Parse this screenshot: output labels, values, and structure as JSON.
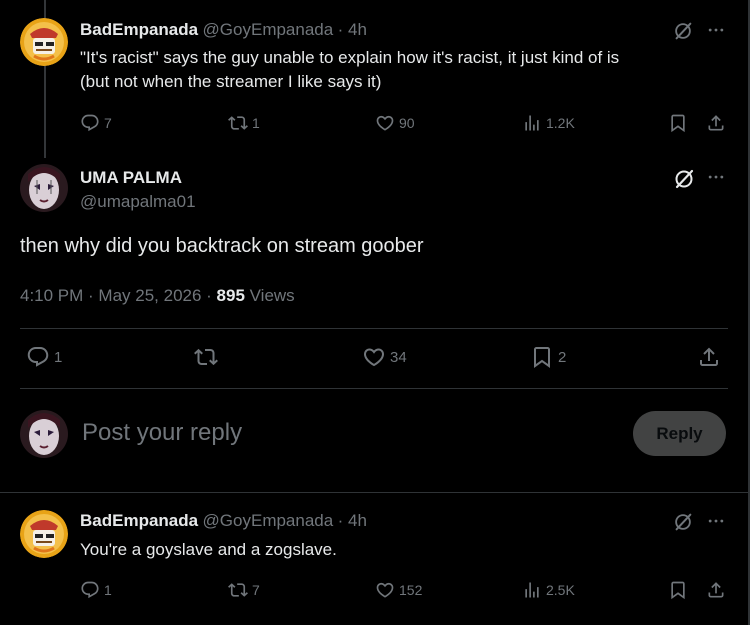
{
  "tweet1": {
    "name": "BadEmpanada",
    "handle": "@GoyEmpanada",
    "time": "· 4h",
    "text_line1": "\"It's racist\" says the guy unable to explain how it's racist, it just kind of is",
    "text_line2": "(but not when the streamer I like says it)",
    "replies": "7",
    "reposts": "1",
    "likes": "90",
    "views": "1.2K"
  },
  "main_tweet": {
    "name": "UMA PALMA",
    "handle": "@umapalma01",
    "text": "then why did you backtrack on stream goober",
    "timestamp": "4:10 PM · May 25, 2026 · ",
    "view_count": "895",
    "views_label": " Views",
    "replies": "1",
    "reposts": "",
    "likes": "34",
    "bookmarks": "2"
  },
  "composer": {
    "placeholder": "Post your reply",
    "reply_label": "Reply"
  },
  "tweet2": {
    "name": "BadEmpanada",
    "handle": "@GoyEmpanada",
    "time": "· 4h",
    "text": "You're a goyslave and a zogslave.",
    "replies": "1",
    "reposts": "7",
    "likes": "152",
    "views": "2.5K"
  },
  "colors": {
    "background": "#000000",
    "text_primary": "#e7e9ea",
    "text_secondary": "#71767b",
    "divider": "#2f3336"
  }
}
